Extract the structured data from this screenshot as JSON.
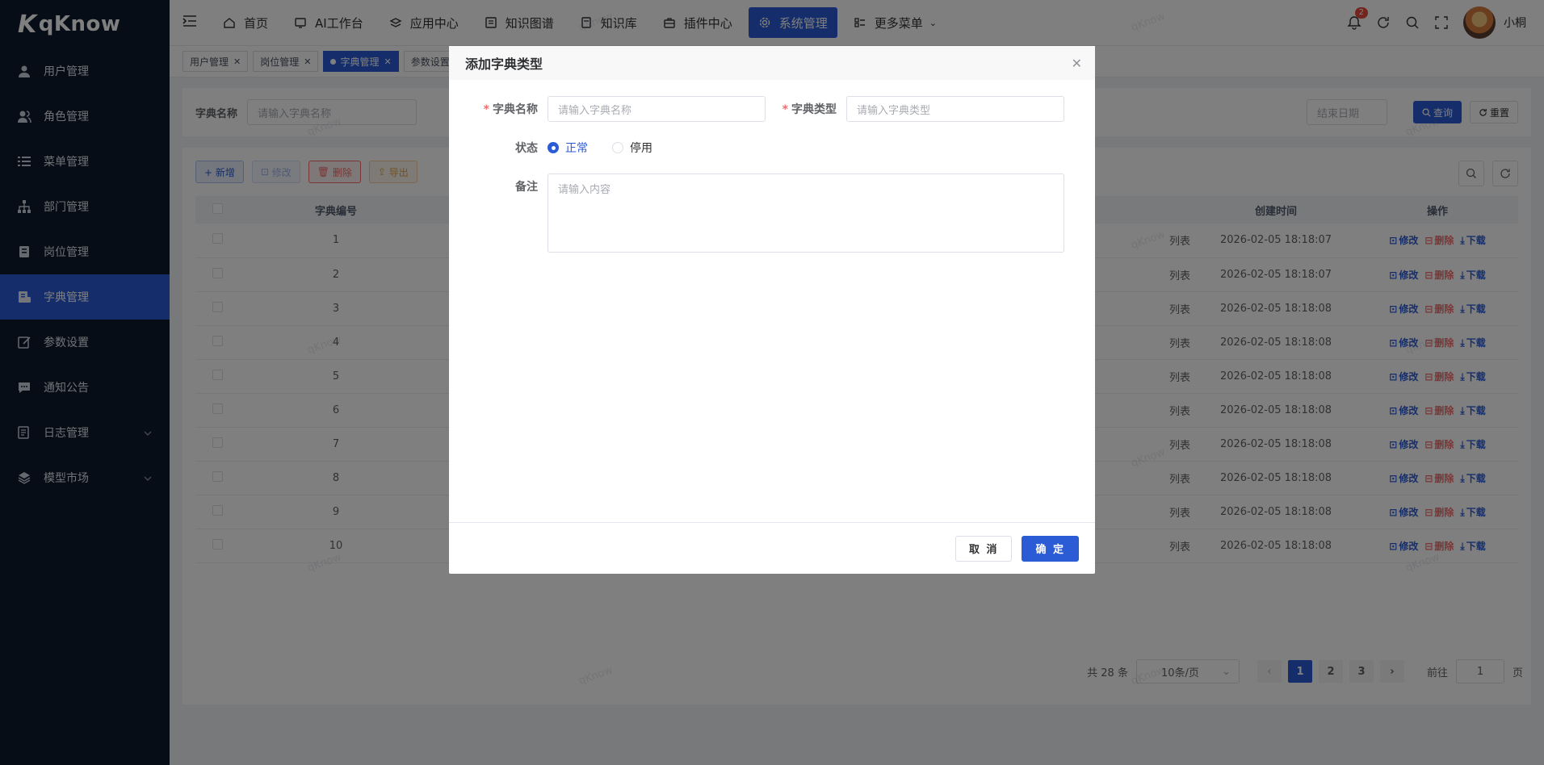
{
  "app": {
    "logo": "qKnow",
    "watermark": "qKnow"
  },
  "sidebar": {
    "items": [
      {
        "label": "用户管理",
        "icon": "user-icon"
      },
      {
        "label": "角色管理",
        "icon": "role-icon"
      },
      {
        "label": "菜单管理",
        "icon": "menu-icon"
      },
      {
        "label": "部门管理",
        "icon": "dept-icon"
      },
      {
        "label": "岗位管理",
        "icon": "post-icon"
      },
      {
        "label": "字典管理",
        "icon": "dict-icon",
        "active": true
      },
      {
        "label": "参数设置",
        "icon": "edit-icon"
      },
      {
        "label": "通知公告",
        "icon": "message-icon"
      },
      {
        "label": "日志管理",
        "icon": "log-icon",
        "expandable": true
      },
      {
        "label": "模型市场",
        "icon": "model-icon",
        "expandable": true
      }
    ]
  },
  "topnav": {
    "items": [
      {
        "label": "首页",
        "icon": "home-icon"
      },
      {
        "label": "AI工作台",
        "icon": "monitor-icon"
      },
      {
        "label": "应用中心",
        "icon": "apps-icon"
      },
      {
        "label": "知识图谱",
        "icon": "graph-icon"
      },
      {
        "label": "知识库",
        "icon": "book-icon"
      },
      {
        "label": "插件中心",
        "icon": "plugin-icon"
      },
      {
        "label": "系统管理",
        "icon": "gear-icon",
        "active": true
      },
      {
        "label": "更多菜单",
        "icon": "more-icon"
      }
    ],
    "notification_count": "2",
    "username": "小桐"
  },
  "tags": [
    {
      "label": "用户管理"
    },
    {
      "label": "岗位管理"
    },
    {
      "label": "字典管理",
      "active": true
    },
    {
      "label": "参数设置"
    }
  ],
  "search": {
    "name_label": "字典名称",
    "name_placeholder": "请输入字典名称",
    "end_date_placeholder": "结束日期",
    "query_label": "查询",
    "reset_label": "重置"
  },
  "toolbar": {
    "add": "+ 新增",
    "edit": "修改",
    "delete": "删除",
    "export": "导出"
  },
  "table": {
    "columns": {
      "id": "字典编号",
      "created": "创建时间",
      "ops": "操作"
    },
    "remark_fragment": "列表",
    "rows": [
      {
        "id": "1",
        "created": "2026-02-05 18:18:07"
      },
      {
        "id": "2",
        "created": "2026-02-05 18:18:07"
      },
      {
        "id": "3",
        "created": "2026-02-05 18:18:08"
      },
      {
        "id": "4",
        "created": "2026-02-05 18:18:08"
      },
      {
        "id": "5",
        "created": "2026-02-05 18:18:08"
      },
      {
        "id": "6",
        "created": "2026-02-05 18:18:08"
      },
      {
        "id": "7",
        "created": "2026-02-05 18:18:08"
      },
      {
        "id": "8",
        "created": "2026-02-05 18:18:08"
      },
      {
        "id": "9",
        "created": "2026-02-05 18:18:08"
      },
      {
        "id": "10",
        "created": "2026-02-05 18:18:08"
      }
    ],
    "op_edit": "修改",
    "op_delete": "删除",
    "op_download": "下载"
  },
  "pager": {
    "total": "共 28 条",
    "page_size": "10条/页",
    "pages": [
      "1",
      "2",
      "3"
    ],
    "current": "1",
    "goto_label": "前往",
    "goto_value": "1",
    "page_suffix": "页"
  },
  "dialog": {
    "title": "添加字典类型",
    "name_label": "字典名称",
    "name_placeholder": "请输入字典名称",
    "type_label": "字典类型",
    "type_placeholder": "请输入字典类型",
    "status_label": "状态",
    "status_normal": "正常",
    "status_disabled": "停用",
    "remark_label": "备注",
    "remark_placeholder": "请输入内容",
    "cancel": "取 消",
    "confirm": "确 定"
  },
  "colors": {
    "primary": "#2b5cd6",
    "sidebar_bg": "#0f1a2e",
    "danger": "#f56c6c",
    "warning": "#e6a23c"
  }
}
